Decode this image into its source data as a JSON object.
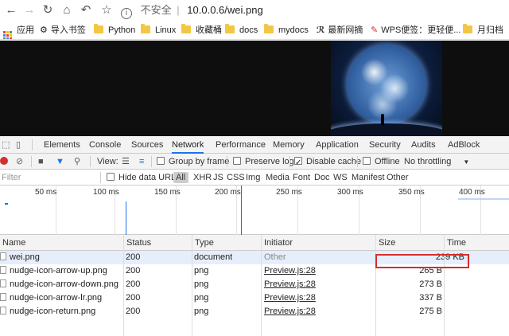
{
  "browser": {
    "back_icon": "back-arrow-icon",
    "forward_icon": "forward-arrow-icon",
    "reload_icon": "reload-icon",
    "home_icon": "home-icon",
    "undo_icon": "undo-icon",
    "star_icon": "bookmark-star-icon",
    "address": {
      "security_label": "不安全",
      "separator": "|",
      "url": "10.0.0.6/wei.png"
    }
  },
  "bookmarks": [
    {
      "label": "应用",
      "icon": "apps-grid-icon"
    },
    {
      "label": "导入书签",
      "icon": "gear-icon"
    },
    {
      "label": "Python",
      "icon": "folder-icon"
    },
    {
      "label": "Linux",
      "icon": "folder-icon"
    },
    {
      "label": "收藏桶",
      "icon": "folder-icon"
    },
    {
      "label": "docs",
      "icon": "folder-icon"
    },
    {
      "label": "mydocs",
      "icon": "folder-icon"
    },
    {
      "label": "最新网摘",
      "icon": "zhihu-icon"
    },
    {
      "label": "WPS便签：更轻便...",
      "icon": "wps-icon"
    },
    {
      "label": "月归档",
      "icon": "folder-icon"
    }
  ],
  "devtools": {
    "tabs": [
      "Elements",
      "Console",
      "Sources",
      "Network",
      "Performance",
      "Memory",
      "Application",
      "Security",
      "Audits",
      "AdBlock"
    ],
    "active_tab": "Network",
    "toolbar": {
      "view_label": "View:",
      "group_by_frame": "Group by frame",
      "preserve_log": "Preserve log",
      "disable_cache": "Disable cache",
      "offline": "Offline",
      "throttling": "No throttling"
    },
    "filter": {
      "placeholder": "Filter",
      "hide_data_urls": "Hide data URLs",
      "types": [
        "All",
        "XHR",
        "JS",
        "CSS",
        "Img",
        "Media",
        "Font",
        "Doc",
        "WS",
        "Manifest",
        "Other"
      ]
    },
    "timeline": {
      "ticks": [
        "50 ms",
        "100 ms",
        "150 ms",
        "200 ms",
        "250 ms",
        "300 ms",
        "350 ms",
        "400 ms"
      ]
    },
    "table": {
      "headers": {
        "name": "Name",
        "status": "Status",
        "type": "Type",
        "initiator": "Initiator",
        "size": "Size",
        "time": "Time"
      },
      "rows": [
        {
          "name": "wei.png",
          "status": "200",
          "type": "document",
          "initiator": "Other",
          "size": "239 KB"
        },
        {
          "name": "nudge-icon-arrow-up.png",
          "status": "200",
          "type": "png",
          "initiator": "Preview.js:28",
          "size": "265 B"
        },
        {
          "name": "nudge-icon-arrow-down.png",
          "status": "200",
          "type": "png",
          "initiator": "Preview.js:28",
          "size": "273 B"
        },
        {
          "name": "nudge-icon-arrow-lr.png",
          "status": "200",
          "type": "png",
          "initiator": "Preview.js:28",
          "size": "337 B"
        },
        {
          "name": "nudge-icon-return.png",
          "status": "200",
          "type": "png",
          "initiator": "Preview.js:28",
          "size": "275 B"
        }
      ]
    }
  },
  "colors": {
    "accent": "#1a73e8",
    "record": "#d32f2f",
    "highlight_box": "#d32f2f",
    "selected_row": "#e6eefb"
  }
}
